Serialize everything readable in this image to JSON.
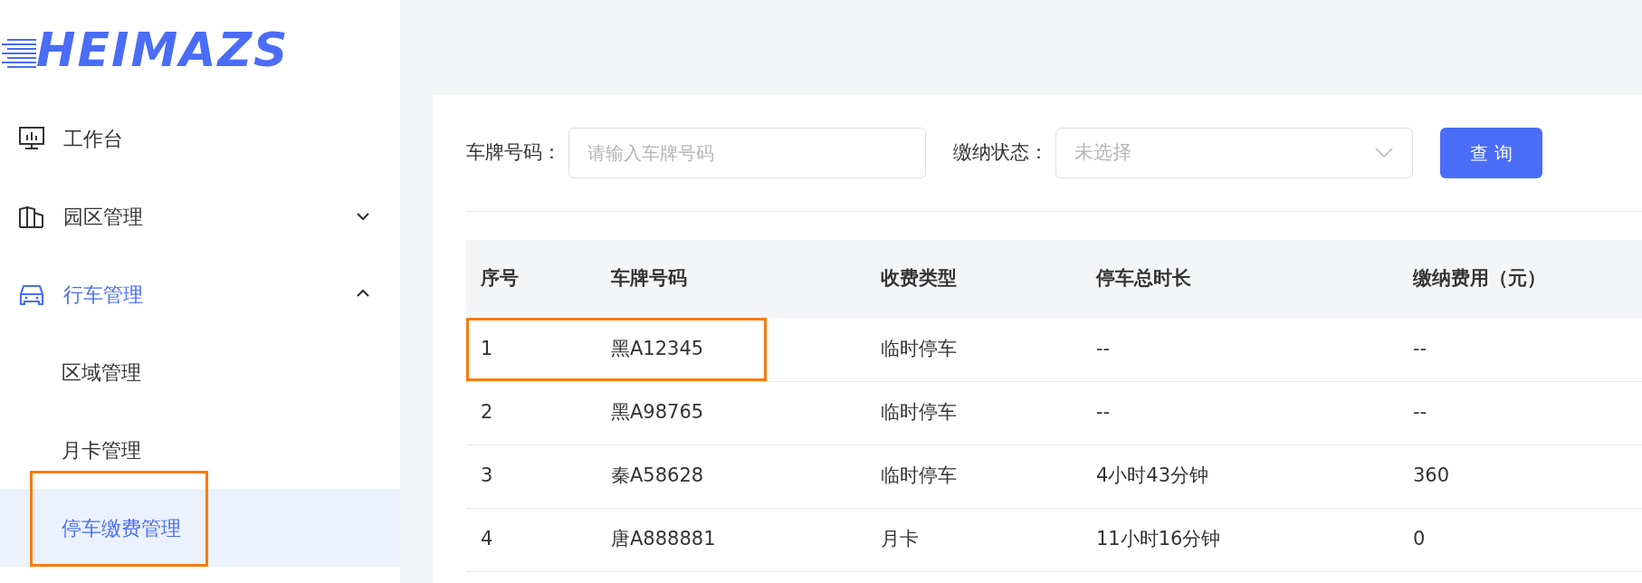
{
  "logo": {
    "text": "HEIMAZS"
  },
  "sidebar": {
    "items": [
      {
        "label": "工作台",
        "active": false
      },
      {
        "label": "园区管理",
        "active": false,
        "expanded": false
      },
      {
        "label": "行车管理",
        "active": true,
        "expanded": true,
        "children": [
          {
            "label": "区域管理",
            "selected": false,
            "highlighted": false
          },
          {
            "label": "月卡管理",
            "selected": false,
            "highlighted": false
          },
          {
            "label": "停车缴费管理",
            "selected": true,
            "highlighted": true
          }
        ]
      }
    ]
  },
  "filters": [
    {
      "kind": "text",
      "label": "车牌号码：",
      "placeholder": "请输入车牌号码"
    },
    {
      "kind": "select",
      "label": "缴纳状态：",
      "placeholder": "未选择"
    }
  ],
  "search_button": "查 询",
  "table": {
    "columns": [
      "序号",
      "车牌号码",
      "收费类型",
      "停车总时长",
      "缴纳费用（元）"
    ],
    "rows": [
      {
        "cells": [
          "1",
          "黑A12345",
          "临时停车",
          "--",
          "--"
        ],
        "highlighted": true
      },
      {
        "cells": [
          "2",
          "黑A98765",
          "临时停车",
          "--",
          "--"
        ],
        "highlighted": false
      },
      {
        "cells": [
          "3",
          "秦A58628",
          "临时停车",
          "4小时43分钟",
          "360"
        ],
        "highlighted": false
      },
      {
        "cells": [
          "4",
          "唐A888881",
          "月卡",
          "11小时16分钟",
          "0"
        ],
        "highlighted": false
      }
    ]
  }
}
